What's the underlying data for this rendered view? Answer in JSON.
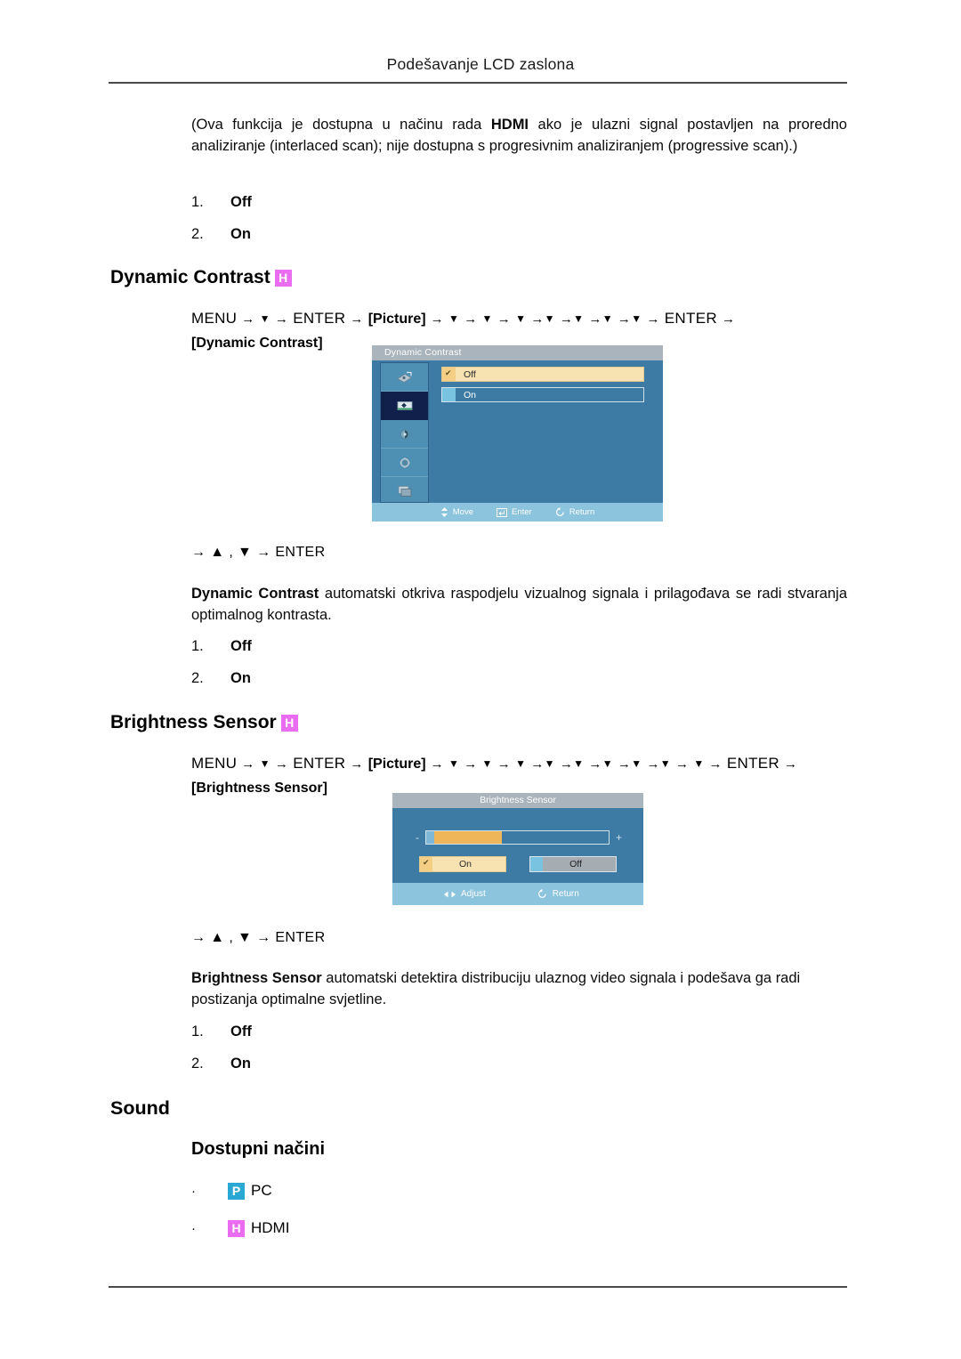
{
  "header": {
    "title": "Podešavanje LCD zaslona"
  },
  "intro": {
    "paragraph_pre": "(Ova funkcija je dostupna u načinu rada ",
    "paragraph_bold": "HDMI",
    "paragraph_post": " ako je ulazni signal postavljen na proredno analiziranje (interlaced scan); nije dostupna s progresivnim analiziranjem (progressive scan).)",
    "list": [
      {
        "num": "1.",
        "label": "Off"
      },
      {
        "num": "2.",
        "label": "On"
      }
    ]
  },
  "dynamic_contrast": {
    "heading": "Dynamic Contrast",
    "badge": "H",
    "badge_color": "#ea6cf0",
    "menu_path": {
      "menu": "MENU",
      "arrow": "→",
      "down": "▼",
      "up": "▲",
      "enter": "ENTER",
      "picture": "[Picture]",
      "target": "[Dynamic Contrast]",
      "down_count": 7
    },
    "arrow_line": "→ ▲ , ▼ → ENTER",
    "description_bold": "Dynamic Contrast",
    "description_rest": " automatski otkriva raspodjelu vizualnog signala i prilagođava se radi stvaranja optimalnog kontrasta.",
    "list": [
      {
        "num": "1.",
        "label": "Off"
      },
      {
        "num": "2.",
        "label": "On"
      }
    ],
    "osd": {
      "title": "Dynamic Contrast",
      "sidebar_icons": [
        "input-source-icon",
        "picture-icon",
        "sound-icon",
        "setup-icon",
        "multi-control-icon"
      ],
      "selected_sidebar_index": 1,
      "options": [
        {
          "label": "Off",
          "selected": true
        },
        {
          "label": "On",
          "selected": false
        }
      ],
      "footer": [
        {
          "icon": "updown-arrow-icon",
          "label": "Move"
        },
        {
          "icon": "enter-key-icon",
          "label": "Enter"
        },
        {
          "icon": "return-arrow-icon",
          "label": "Return"
        }
      ]
    }
  },
  "brightness_sensor": {
    "heading": "Brightness Sensor",
    "badge": "H",
    "badge_color": "#ea6cf0",
    "menu_path": {
      "menu": "MENU",
      "arrow": "→",
      "down": "▼",
      "up": "▲",
      "enter": "ENTER",
      "picture": "[Picture]",
      "target": "[Brightness Sensor]",
      "down_count": 9
    },
    "arrow_line": "→ ▲ , ▼ → ENTER",
    "description_bold": "Brightness Sensor",
    "description_rest": "  automatski detektira distribuciju ulaznog video signala i podešava ga radi postizanja optimalne svjetline.",
    "list": [
      {
        "num": "1.",
        "label": "Off"
      },
      {
        "num": "2.",
        "label": "On"
      }
    ],
    "osd": {
      "title": "Brightness Sensor",
      "slider": {
        "minus": "-",
        "plus": "+",
        "fill_percent": 37
      },
      "buttons": [
        {
          "label": "On",
          "selected": true
        },
        {
          "label": "Off",
          "selected": false
        }
      ],
      "footer": [
        {
          "icon": "leftright-arrow-icon",
          "label": "Adjust"
        },
        {
          "icon": "return-arrow-icon",
          "label": "Return"
        }
      ]
    }
  },
  "sound": {
    "heading": "Sound",
    "subheading": "Dostupni načini",
    "modes": [
      {
        "bullet": "·",
        "badge": "P",
        "badge_color": "#2aa8d4",
        "label": "PC"
      },
      {
        "bullet": "·",
        "badge": "H",
        "badge_color": "#ea6cf0",
        "label": "HDMI"
      }
    ]
  }
}
